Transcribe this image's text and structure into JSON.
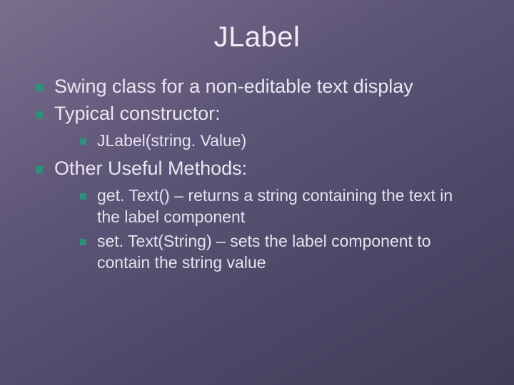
{
  "title": "JLabel",
  "bullets": {
    "item1": "Swing class for a non-editable text display",
    "item2": "Typical constructor:",
    "item2_sub1": "JLabel(string. Value)",
    "item3": "Other Useful Methods:",
    "item3_sub1_name": "get. Text()",
    "item3_sub1_desc": " – returns a string containing the text in the label component",
    "item3_sub2_name": "set. Text(String)",
    "item3_sub2_desc": " – sets the label component to contain the string value"
  },
  "colors": {
    "bullet": "#2f8f7a",
    "text": "#eae6f0"
  }
}
